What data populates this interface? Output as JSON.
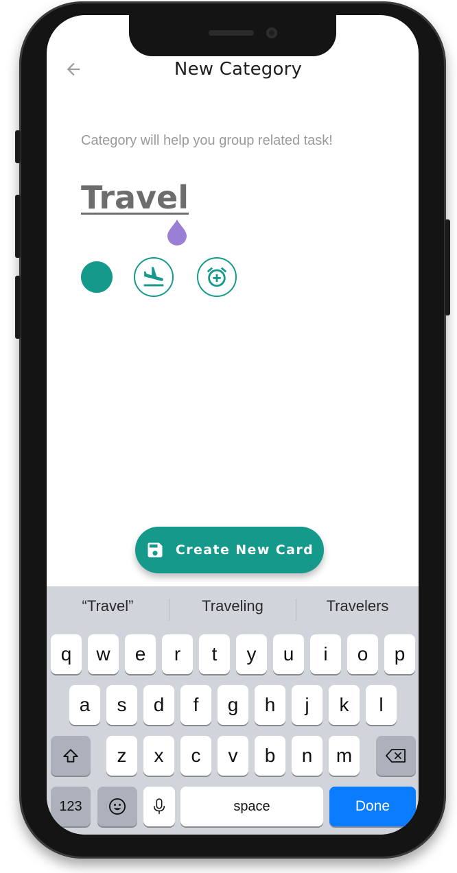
{
  "header": {
    "title": "New Category"
  },
  "subtitle": "Category will help you group related task!",
  "category_input": {
    "value": "Travel"
  },
  "colors": {
    "accent": "#14998b",
    "cursor_handle": "#9b7fd4",
    "done_key": "#0a7cff"
  },
  "icons": [
    "back-arrow-icon",
    "flight-land-icon",
    "alarm-add-icon",
    "save-icon",
    "shift-icon",
    "backspace-icon",
    "emoji-icon",
    "mic-icon"
  ],
  "fab": {
    "label": "Create New Card"
  },
  "keyboard": {
    "suggestions": [
      "“Travel”",
      "Traveling",
      "Travelers"
    ],
    "row1": [
      "q",
      "w",
      "e",
      "r",
      "t",
      "y",
      "u",
      "i",
      "o",
      "p"
    ],
    "row2": [
      "a",
      "s",
      "d",
      "f",
      "g",
      "h",
      "j",
      "k",
      "l"
    ],
    "row3": [
      "z",
      "x",
      "c",
      "v",
      "b",
      "n",
      "m"
    ],
    "numbers_key": "123",
    "space_key": "space",
    "done_key": "Done"
  }
}
